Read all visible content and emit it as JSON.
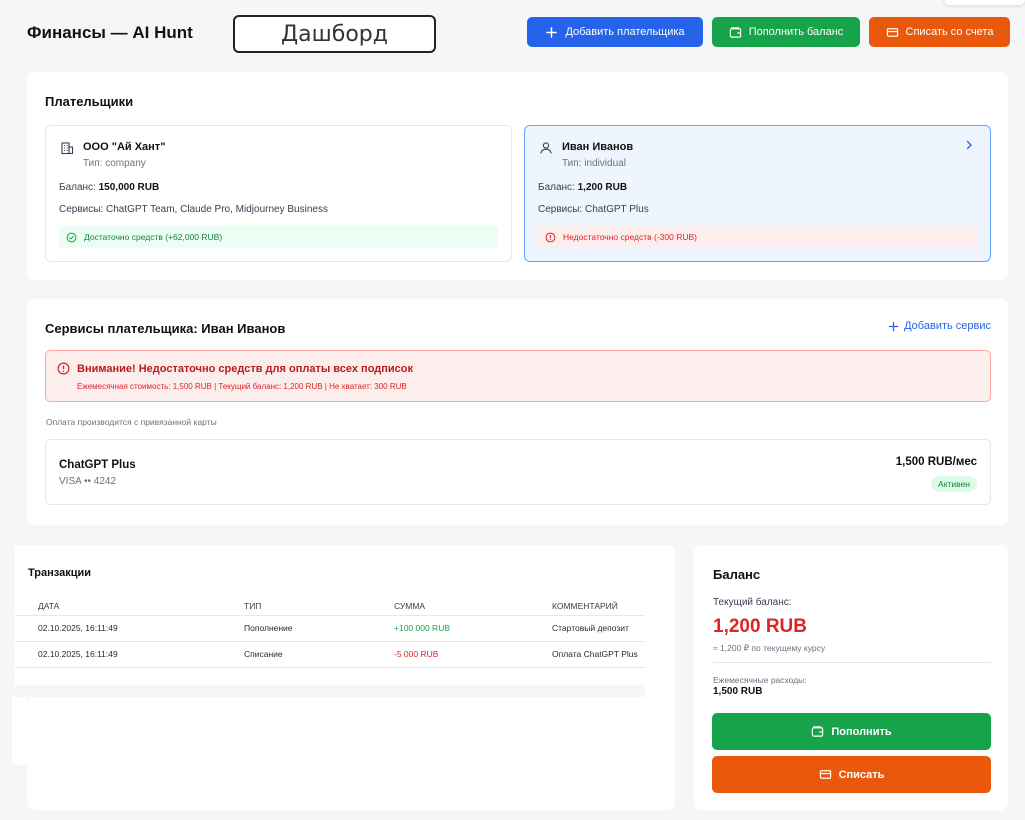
{
  "header": {
    "title": "Финансы — AI Hunt",
    "dashboard_label": "Дашборд",
    "add_payer": "Добавить плательщика",
    "top_up": "Пополнить баланс",
    "debit": "Списать со счета"
  },
  "payers": {
    "title": "Плательщики",
    "items": [
      {
        "name": "ООО \"Ай Хант\"",
        "type": "Тип: company",
        "balance_label": "Баланс:",
        "balance_value": "150,000 RUB",
        "services": "Сервисы: ChatGPT Team, Claude Pro, Midjourney Business",
        "status": "Достаточно средств (+62,000 RUB)",
        "icon": "building-icon"
      },
      {
        "name": "Иван Иванов",
        "type": "Тип: individual",
        "balance_label": "Баланс:",
        "balance_value": "1,200 RUB",
        "services": "Сервисы: ChatGPT Plus",
        "status": "Недостаточно средств (-300 RUB)",
        "icon": "user-icon"
      }
    ]
  },
  "services": {
    "title": "Сервисы плательщика: Иван Иванов",
    "add_service": "Добавить сервис",
    "alert_title": "Внимание! Недостаточно средств для оплаты всех подписок",
    "alert_details": "Ежемесячная стоимость: 1,500 RUB | Текущий баланс: 1,200 RUB | Не хватает: 300 RUB",
    "payment_note": "Оплата производится с привязанной карты",
    "subscription": {
      "name": "ChatGPT Plus",
      "card": "VISA •• 4242",
      "price": "1,500 RUB/мес",
      "status": "Активен"
    }
  },
  "transactions": {
    "title": "Транзакции",
    "columns": [
      "ДАТА",
      "ТИП",
      "СУММА",
      "КОММЕНТАРИЙ"
    ],
    "rows": [
      [
        "02.10.2025, 16:11:49",
        "Пополнение",
        "+100 000 RUB",
        "Стартовый депозит"
      ],
      [
        "02.10.2025, 16:11:49",
        "Списание",
        "-5 000 RUB",
        "Оплата ChatGPT Plus"
      ]
    ]
  },
  "balance": {
    "title": "Баланс",
    "current_label": "Текущий баланс:",
    "current_value": "1,200 RUB",
    "approx": "≈ 1,200 ₽ по текущему курсу",
    "monthly_label": "Ежемесячные расходы:",
    "monthly_value": "1,500 RUB",
    "top_up": "Пополнить",
    "debit": "Списать"
  },
  "colors": {
    "primary": "#2563eb",
    "success": "#16a34a",
    "warning": "#ea580c",
    "danger": "#dc2626"
  }
}
